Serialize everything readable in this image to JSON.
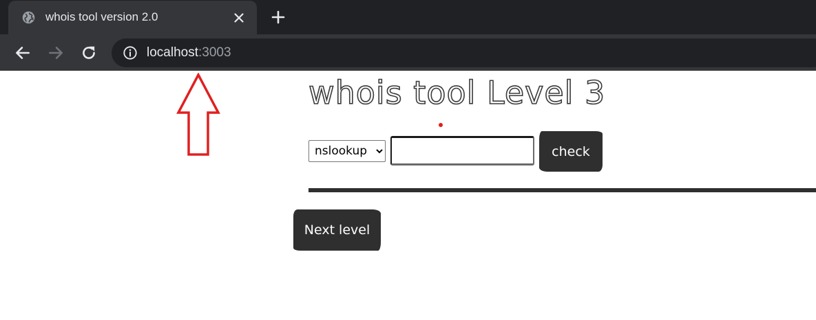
{
  "browser": {
    "tab": {
      "title": "whois tool version 2.0",
      "favicon": "globe-icon",
      "close_icon": "close-icon"
    },
    "new_tab_icon": "plus-icon",
    "nav": {
      "back_icon": "arrow-left-icon",
      "forward_icon": "arrow-right-icon",
      "reload_icon": "reload-icon"
    },
    "address_bar": {
      "info_icon": "info-icon",
      "host": "localhost",
      "port": ":3003"
    }
  },
  "annotation": {
    "icon": "up-arrow-icon",
    "color": "#e02020"
  },
  "page": {
    "heading": "whois tool Level 3",
    "tool_select": {
      "selected": "nslookup",
      "options": [
        "nslookup"
      ]
    },
    "domain_input": {
      "value": "",
      "placeholder": ""
    },
    "check_button": "check",
    "next_level_button": "Next level"
  },
  "colors": {
    "chrome_dark": "#202124",
    "chrome_tab": "#35363a",
    "button_bg": "#2f2f2f",
    "annotation_red": "#e02020"
  }
}
